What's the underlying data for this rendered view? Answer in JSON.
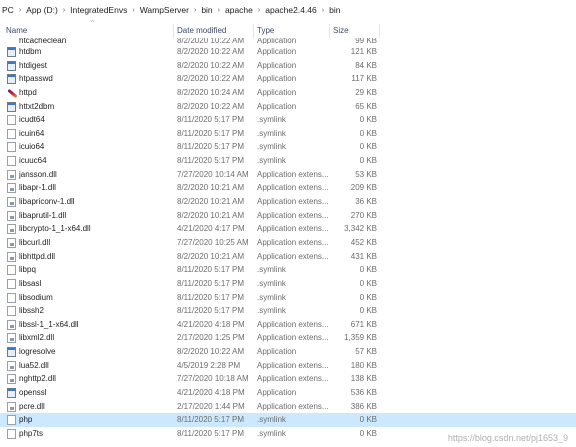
{
  "breadcrumb": [
    "PC",
    "App (D:)",
    "IntegratedEnvs",
    "WampServer",
    "bin",
    "apache",
    "apache2.4.46",
    "bin"
  ],
  "columns": {
    "name": "Name",
    "date": "Date modified",
    "type": "Type",
    "size": "Size"
  },
  "rows": [
    {
      "name": "htcacheclean",
      "date": "8/2/2020 10:22 AM",
      "type": "Application",
      "size": "99 KB",
      "icon": "app-icon"
    },
    {
      "name": "htdbm",
      "date": "8/2/2020 10:22 AM",
      "type": "Application",
      "size": "121 KB",
      "icon": "app-icon"
    },
    {
      "name": "htdigest",
      "date": "8/2/2020 10:22 AM",
      "type": "Application",
      "size": "84 KB",
      "icon": "app-icon"
    },
    {
      "name": "htpasswd",
      "date": "8/2/2020 10:22 AM",
      "type": "Application",
      "size": "117 KB",
      "icon": "app-icon"
    },
    {
      "name": "httpd",
      "date": "8/2/2020 10:24 AM",
      "type": "Application",
      "size": "29 KB",
      "icon": "feather-icon"
    },
    {
      "name": "httxt2dbm",
      "date": "8/2/2020 10:22 AM",
      "type": "Application",
      "size": "65 KB",
      "icon": "app-icon"
    },
    {
      "name": "icudt64",
      "date": "8/11/2020 5:17 PM",
      "type": ".symlink",
      "size": "0 KB",
      "icon": "file-icon"
    },
    {
      "name": "icuin64",
      "date": "8/11/2020 5:17 PM",
      "type": ".symlink",
      "size": "0 KB",
      "icon": "file-icon"
    },
    {
      "name": "icuio64",
      "date": "8/11/2020 5:17 PM",
      "type": ".symlink",
      "size": "0 KB",
      "icon": "file-icon"
    },
    {
      "name": "icuuc64",
      "date": "8/11/2020 5:17 PM",
      "type": ".symlink",
      "size": "0 KB",
      "icon": "file-icon"
    },
    {
      "name": "jansson.dll",
      "date": "7/27/2020 10:14 AM",
      "type": "Application extens...",
      "size": "53 KB",
      "icon": "dll-icon"
    },
    {
      "name": "libapr-1.dll",
      "date": "8/2/2020 10:21 AM",
      "type": "Application extens...",
      "size": "209 KB",
      "icon": "dll-icon"
    },
    {
      "name": "libapriconv-1.dll",
      "date": "8/2/2020 10:21 AM",
      "type": "Application extens...",
      "size": "36 KB",
      "icon": "dll-icon"
    },
    {
      "name": "libaprutil-1.dll",
      "date": "8/2/2020 10:21 AM",
      "type": "Application extens...",
      "size": "270 KB",
      "icon": "dll-icon"
    },
    {
      "name": "libcrypto-1_1-x64.dll",
      "date": "4/21/2020 4:17 PM",
      "type": "Application extens...",
      "size": "3,342 KB",
      "icon": "dll-icon"
    },
    {
      "name": "libcurl.dll",
      "date": "7/27/2020 10:25 AM",
      "type": "Application extens...",
      "size": "452 KB",
      "icon": "dll-icon"
    },
    {
      "name": "libhttpd.dll",
      "date": "8/2/2020 10:21 AM",
      "type": "Application extens...",
      "size": "431 KB",
      "icon": "dll-icon"
    },
    {
      "name": "libpq",
      "date": "8/11/2020 5:17 PM",
      "type": ".symlink",
      "size": "0 KB",
      "icon": "file-icon"
    },
    {
      "name": "libsasl",
      "date": "8/11/2020 5:17 PM",
      "type": ".symlink",
      "size": "0 KB",
      "icon": "file-icon"
    },
    {
      "name": "libsodium",
      "date": "8/11/2020 5:17 PM",
      "type": ".symlink",
      "size": "0 KB",
      "icon": "file-icon"
    },
    {
      "name": "libssh2",
      "date": "8/11/2020 5:17 PM",
      "type": ".symlink",
      "size": "0 KB",
      "icon": "file-icon"
    },
    {
      "name": "libssl-1_1-x64.dll",
      "date": "4/21/2020 4:18 PM",
      "type": "Application extens...",
      "size": "671 KB",
      "icon": "dll-icon"
    },
    {
      "name": "libxml2.dll",
      "date": "2/17/2020 1:25 PM",
      "type": "Application extens...",
      "size": "1,359 KB",
      "icon": "dll-icon"
    },
    {
      "name": "logresolve",
      "date": "8/2/2020 10:22 AM",
      "type": "Application",
      "size": "57 KB",
      "icon": "app-icon"
    },
    {
      "name": "lua52.dll",
      "date": "4/5/2019 2:28 PM",
      "type": "Application extens...",
      "size": "180 KB",
      "icon": "dll-icon"
    },
    {
      "name": "nghttp2.dll",
      "date": "7/27/2020 10:18 AM",
      "type": "Application extens...",
      "size": "138 KB",
      "icon": "dll-icon"
    },
    {
      "name": "openssl",
      "date": "4/21/2020 4:18 PM",
      "type": "Application",
      "size": "536 KB",
      "icon": "app-icon"
    },
    {
      "name": "pcre.dll",
      "date": "2/17/2020 1:44 PM",
      "type": "Application extens...",
      "size": "386 KB",
      "icon": "dll-icon"
    },
    {
      "name": "php",
      "date": "8/11/2020 5:17 PM",
      "type": ".symlink",
      "size": "0 KB",
      "icon": "file-icon",
      "selected": true
    },
    {
      "name": "php7ts",
      "date": "8/11/2020 5:17 PM",
      "type": ".symlink",
      "size": "0 KB",
      "icon": "file-icon"
    }
  ],
  "watermark": "https://blog.csdn.net/pj1653_9"
}
